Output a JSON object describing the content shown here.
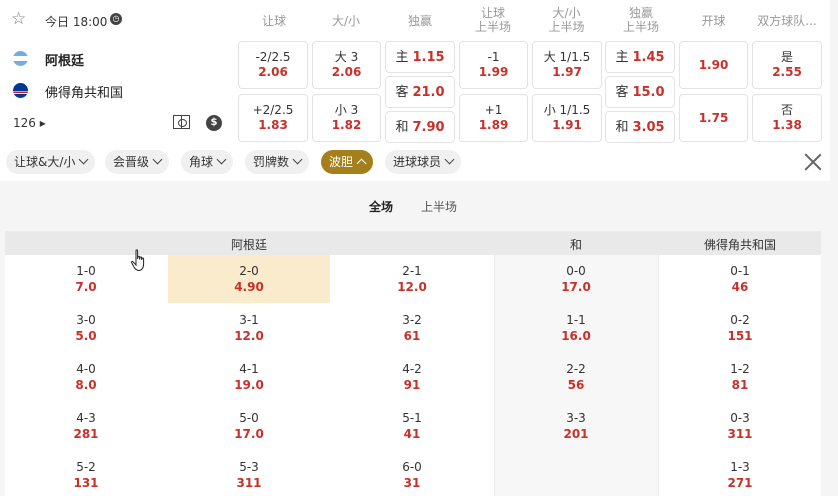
{
  "match": {
    "time": "今日 18:00",
    "home": "阿根廷",
    "away": "佛得角共和国",
    "more_count": "126"
  },
  "headers": {
    "handicap": "让球",
    "over_under": "大/小",
    "moneyline": "独赢",
    "handicap_1h": [
      "让球",
      "上半场"
    ],
    "over_under_1h": [
      "大/小",
      "上半场"
    ],
    "moneyline_1h": [
      "独赢",
      "上半场"
    ],
    "first_goal": "开球",
    "btts": "双方球队..."
  },
  "odds": {
    "handicap": [
      {
        "line": "-2/2.5",
        "odd": "2.06"
      },
      {
        "line": "+2/2.5",
        "odd": "1.83"
      }
    ],
    "over_under": [
      {
        "line": "大 3",
        "odd": "2.06"
      },
      {
        "line": "小 3",
        "odd": "1.82"
      }
    ],
    "moneyline": [
      {
        "label": "主",
        "odd": "1.15"
      },
      {
        "label": "客",
        "odd": "21.0"
      },
      {
        "label": "和",
        "odd": "7.90"
      }
    ],
    "handicap_1h": [
      {
        "line": "-1",
        "odd": "1.99"
      },
      {
        "line": "+1",
        "odd": "1.89"
      }
    ],
    "over_under_1h": [
      {
        "line": "大 1/1.5",
        "odd": "1.97"
      },
      {
        "line": "小 1/1.5",
        "odd": "1.91"
      }
    ],
    "moneyline_1h": [
      {
        "label": "主",
        "odd": "1.45"
      },
      {
        "label": "客",
        "odd": "15.0"
      },
      {
        "label": "和",
        "odd": "3.05"
      }
    ],
    "first_goal": [
      "1.90",
      "1.75"
    ],
    "btts": [
      {
        "label": "是",
        "odd": "2.55"
      },
      {
        "label": "否",
        "odd": "1.38"
      }
    ]
  },
  "filters": [
    "让球&大/小",
    "会晋级",
    "角球",
    "罚牌数",
    "波胆",
    "进球球员"
  ],
  "active_filter": "波胆",
  "period_tabs": [
    "全场",
    "上半场"
  ],
  "correct_score": {
    "headers": [
      "阿根廷",
      "和",
      "佛得角共和国"
    ],
    "home": [
      [
        {
          "s": "1-0",
          "v": "7.0"
        },
        {
          "s": "2-0",
          "v": "4.90"
        },
        {
          "s": "2-1",
          "v": "12.0"
        }
      ],
      [
        {
          "s": "3-0",
          "v": "5.0"
        },
        {
          "s": "3-1",
          "v": "12.0"
        },
        {
          "s": "3-2",
          "v": "61"
        }
      ],
      [
        {
          "s": "4-0",
          "v": "8.0"
        },
        {
          "s": "4-1",
          "v": "19.0"
        },
        {
          "s": "4-2",
          "v": "91"
        }
      ],
      [
        {
          "s": "4-3",
          "v": "281"
        },
        {
          "s": "5-0",
          "v": "17.0"
        },
        {
          "s": "5-1",
          "v": "41"
        }
      ],
      [
        {
          "s": "5-2",
          "v": "131"
        },
        {
          "s": "5-3",
          "v": "311"
        },
        {
          "s": "6-0",
          "v": "31"
        }
      ]
    ],
    "draw": [
      {
        "s": "0-0",
        "v": "17.0"
      },
      {
        "s": "1-1",
        "v": "16.0"
      },
      {
        "s": "2-2",
        "v": "56"
      },
      {
        "s": "3-3",
        "v": "201"
      }
    ],
    "away": [
      {
        "s": "0-1",
        "v": "46"
      },
      {
        "s": "0-2",
        "v": "151"
      },
      {
        "s": "1-2",
        "v": "81"
      },
      {
        "s": "0-3",
        "v": "311"
      },
      {
        "s": "1-3",
        "v": "271"
      }
    ]
  }
}
